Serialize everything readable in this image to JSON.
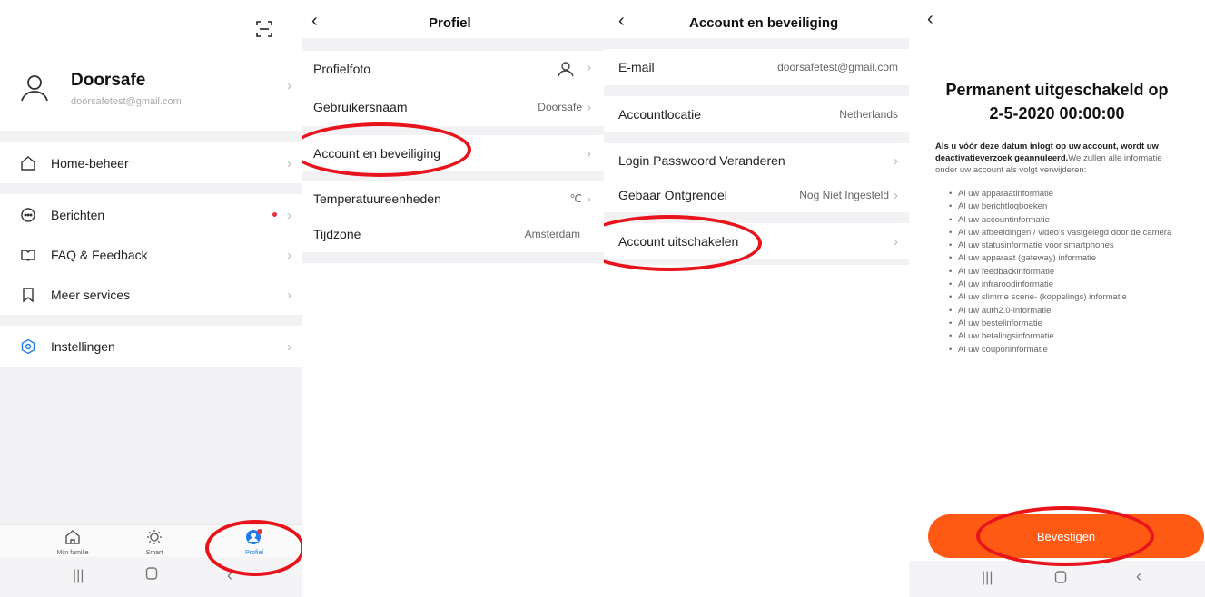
{
  "profile_home": {
    "username": "Doorsafe",
    "email": "doorsafetest@gmail.com",
    "menu": [
      {
        "label": "Home-beheer",
        "icon": "home-icon"
      },
      {
        "label": "Berichten",
        "icon": "message-icon"
      },
      {
        "label": "FAQ & Feedback",
        "icon": "book-icon"
      },
      {
        "label": "Meer services",
        "icon": "bookmark-icon"
      },
      {
        "label": "Instellingen",
        "icon": "settings-icon"
      }
    ],
    "tabs": [
      {
        "label": "Mijn familie"
      },
      {
        "label": "Smart"
      },
      {
        "label": "Profiel"
      }
    ],
    "colors": {
      "accent": "#1f7cf0",
      "badge": "#e8323a",
      "highlight": "#e8131b"
    }
  },
  "profile": {
    "title": "Profiel",
    "rows": [
      {
        "label": "Profielfoto",
        "value": ""
      },
      {
        "label": "Gebruikersnaam",
        "value": "Doorsafe"
      },
      {
        "label": "Account en beveiliging",
        "value": ""
      },
      {
        "label": "Temperatuureenheden",
        "value": "℃"
      },
      {
        "label": "Tijdzone",
        "value": "Amsterdam"
      }
    ]
  },
  "security": {
    "title": "Account en beveiliging",
    "rows": [
      {
        "label": "E-mail",
        "value": "doorsafetest@gmail.com"
      },
      {
        "label": "Accountlocatie",
        "value": "Netherlands"
      },
      {
        "label": "Login Passwoord Veranderen",
        "value": ""
      },
      {
        "label": "Gebaar Ontgrendel",
        "value": "Nog Niet Ingesteld"
      },
      {
        "label": "Account uitschakelen",
        "value": ""
      }
    ]
  },
  "deactivate": {
    "title_line1": "Permanent uitgeschakeld op",
    "title_line2": "2-5-2020 00:00:00",
    "warning_bold": "Als u vóór deze datum inlogt op uw account, wordt uw deactivatieverzoek geannuleerd.",
    "warning_rest": "We zullen alle informatie onder uw account als volgt verwijderen:",
    "items": [
      "Al uw apparaatinformatie",
      "Al uw berichtlogboeken",
      "Al uw accountinformatie",
      "Al uw afbeeldingen / video's vastgelegd door de camera",
      "Al uw statusinformatie voor smartphones",
      "Al uw apparaat (gateway) informatie",
      "Al uw feedbackinformatie",
      "Al uw infraroodinformatie",
      "Al uw slimme scène- (koppelings) informatie",
      "Al uw auth2.0-informatie",
      "Al uw bestelinformatie",
      "Al uw betalingsinformatie",
      "Al uw couponinformatie"
    ],
    "confirm_label": "Bevestigen",
    "colors": {
      "button": "#fe5a14"
    }
  }
}
